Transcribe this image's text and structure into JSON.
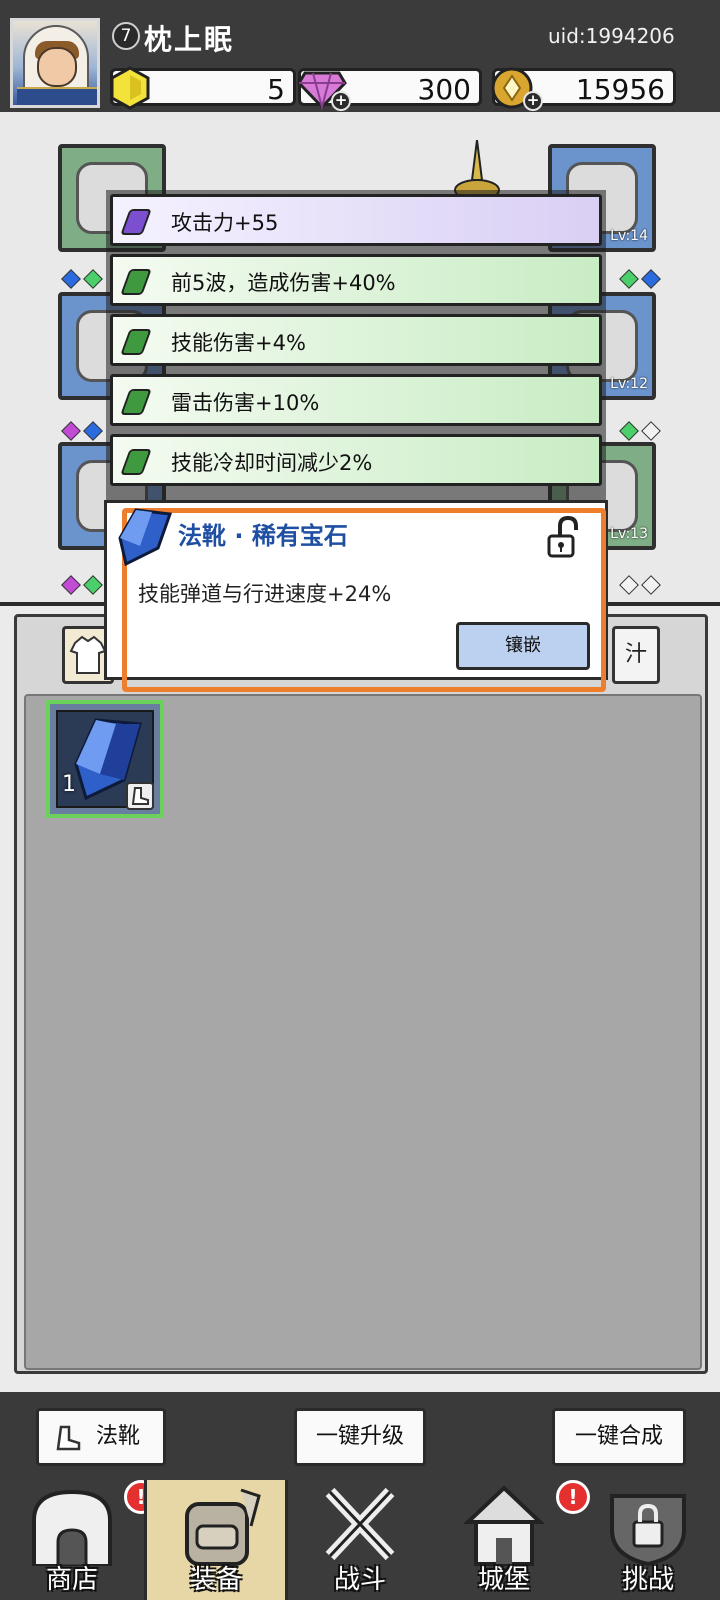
{
  "player": {
    "level": "7",
    "name": "枕上眠",
    "uid": "uid:1994206"
  },
  "resources": {
    "gold": "5",
    "gems": "300",
    "coins": "15956"
  },
  "equipment": {
    "slot_levels": {
      "top_right": "Lv:14",
      "mid_right": "Lv:12",
      "bottom_right": "Lv:13"
    }
  },
  "gem_bonuses": [
    {
      "text": "攻击力+55",
      "quality": "purple"
    },
    {
      "text": "前5波，造成伤害+40%",
      "quality": "green"
    },
    {
      "text": "技能伤害+4%",
      "quality": "green"
    },
    {
      "text": "雷击伤害+10%",
      "quality": "green"
    },
    {
      "text": "技能冷却时间减少2%",
      "quality": "green"
    }
  ],
  "gem_popup": {
    "title": "法靴 · 稀有宝石",
    "description": "技能弹道与行进速度+24%",
    "inlay_label": "镶嵌"
  },
  "inventory": {
    "items": [
      {
        "count": "1",
        "type": "boots-gem"
      }
    ],
    "right_tab_label": "汁"
  },
  "actions": {
    "boots_label": "法靴",
    "upgrade_label": "一键升级",
    "merge_label": "一键合成"
  },
  "nav": {
    "items": [
      {
        "label": "商店",
        "alert": "!"
      },
      {
        "label": "装备"
      },
      {
        "label": "战斗"
      },
      {
        "label": "城堡",
        "alert": "!"
      },
      {
        "label": "挑战"
      }
    ]
  },
  "colors": {
    "accent_orange": "#ef7e2c",
    "title_blue": "#1f4fa3",
    "purple_quality": "#7b4fcf",
    "green_quality": "#3f9a3f"
  }
}
